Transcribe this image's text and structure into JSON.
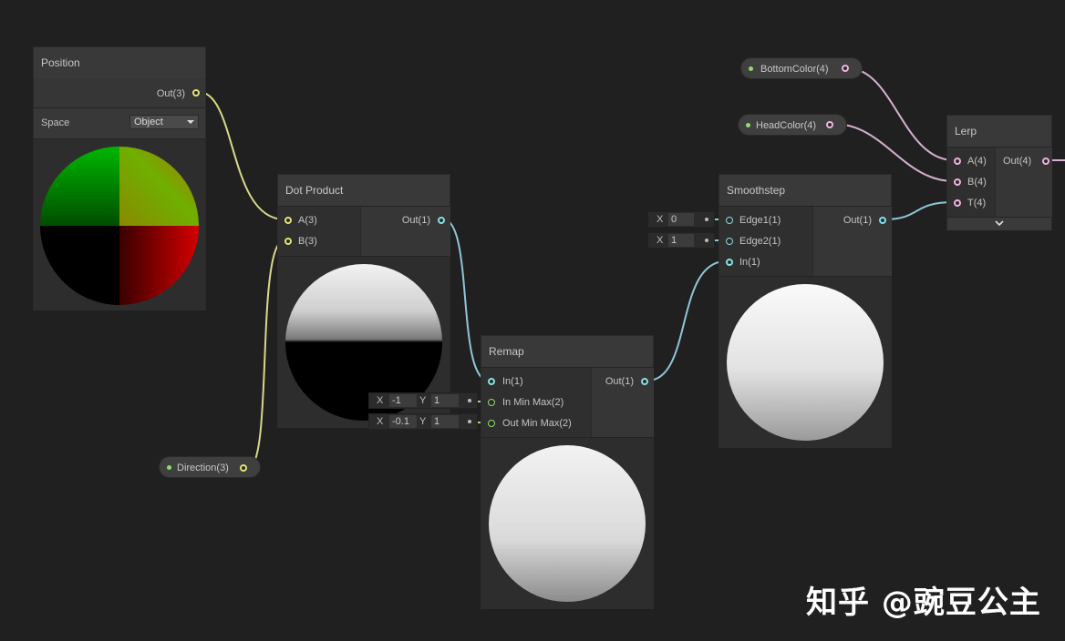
{
  "colors": {
    "background": "#202020",
    "vec3_port": "#e3e376",
    "vec1_port": "#84e0e8",
    "vec2_port": "#8fdc6a",
    "vec4_port": "#f0b2e3",
    "wire_vec3": "#d8d88a",
    "wire_vec1": "#8fc6d6",
    "wire_vec4": "#d7b1d0",
    "wire_vec2": "#9fd97c"
  },
  "nodes": {
    "position": {
      "title": "Position",
      "out": "Out(3)",
      "space_label": "Space",
      "space_value": "Object"
    },
    "dot_product": {
      "title": "Dot Product",
      "in_a": "A(3)",
      "in_b": "B(3)",
      "out": "Out(1)"
    },
    "remap": {
      "title": "Remap",
      "in": "In(1)",
      "in_min_max": "In Min Max(2)",
      "out_min_max": "Out Min Max(2)",
      "out": "Out(1)",
      "in_min_max_vals": {
        "x_label": "X",
        "x": "-1",
        "y_label": "Y",
        "y": "1"
      },
      "out_min_max_vals": {
        "x_label": "X",
        "x": "-0.1",
        "y_label": "Y",
        "y": "1"
      }
    },
    "smoothstep": {
      "title": "Smoothstep",
      "edge1": "Edge1(1)",
      "edge2": "Edge2(1)",
      "in": "In(1)",
      "out": "Out(1)",
      "edge1_val": {
        "x_label": "X",
        "x": "0"
      },
      "edge2_val": {
        "x_label": "X",
        "x": "1"
      }
    },
    "lerp": {
      "title": "Lerp",
      "in_a": "A(4)",
      "in_b": "B(4)",
      "in_t": "T(4)",
      "out": "Out(4)",
      "expand_icon": "chevron-down-icon"
    }
  },
  "properties": {
    "direction": "Direction(3)",
    "bottom_color": "BottomColor(4)",
    "head_color": "HeadColor(4)"
  },
  "watermark": "知乎 @豌豆公主"
}
